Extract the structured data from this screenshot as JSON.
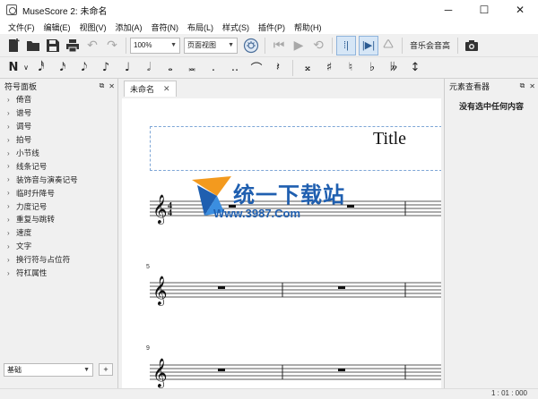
{
  "window": {
    "title": "MuseScore 2: 未命名",
    "minimize": "─",
    "maximize": "☐",
    "close": "✕"
  },
  "menu": [
    "文件(F)",
    "编辑(E)",
    "视图(V)",
    "添加(A)",
    "音符(N)",
    "布局(L)",
    "样式(S)",
    "插件(P)",
    "帮助(H)"
  ],
  "toolbar": {
    "zoom": "100%",
    "view_mode": "页面视图",
    "concert_pitch": "音乐会音高"
  },
  "note_input": {
    "mode": "N",
    "durations": [
      "𝅘𝅥𝅰",
      "𝅘𝅥𝅯",
      "𝅘𝅥𝅮",
      "♪",
      "♩",
      "𝅗𝅥",
      "𝅝",
      "𝅜"
    ],
    "dot": ".",
    "double_dot": "..",
    "tie": "⌒",
    "rest": "𝄽",
    "flip": "↕",
    "accidentals": [
      "𝄪",
      "♯",
      "♮",
      "♭",
      "𝄫"
    ]
  },
  "palette_panel": {
    "title": "符号面板",
    "items": [
      "倚音",
      "谱号",
      "调号",
      "拍号",
      "小节线",
      "线条记号",
      "装饰音与演奏记号",
      "临时升降号",
      "力度记号",
      "重复与跳转",
      "速度",
      "文字",
      "换行符与占位符",
      "符杠属性"
    ],
    "workspace": "基础",
    "add": "+"
  },
  "score": {
    "tab_label": "未命名",
    "title": "Title",
    "time_signature": "4/4",
    "clef": "𝄞",
    "system_numbers": [
      "5",
      "9"
    ]
  },
  "inspector": {
    "title": "元素查看器",
    "message": "没有选中任何内容"
  },
  "watermark": {
    "text": "统一下载站",
    "url": "Www.3987.Com"
  },
  "status": {
    "position": "1 : 01 : 000"
  },
  "colors": {
    "accent_blue": "#1f5fb0",
    "selection_blue": "#7ea6d6"
  }
}
